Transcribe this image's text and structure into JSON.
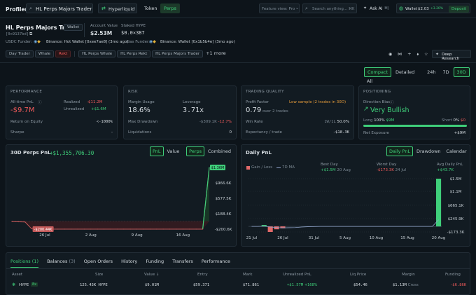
{
  "topbar": {
    "brand": "Profiler",
    "search_value": "HL Perps Majors Trader",
    "network": "Hyperliquid",
    "tab_token": "Token",
    "tab_perps": "Perps",
    "feature_view": "Feature view: Pro",
    "search_placeholder": "Search anything...",
    "search_kbd": "⌘K",
    "ask_ai": "Ask AI",
    "ask_ai_kbd": "⌘J",
    "wallet_label": "Wallet",
    "wallet_price": "$2.03",
    "wallet_change": "+3.20%",
    "deposit": "Deposit"
  },
  "profile": {
    "name": "HL Perps Majors Trader",
    "badge": "Wallet",
    "address": "[0x9137bd]",
    "account_value_label": "Account Value",
    "account_value": "$2.53M",
    "staked_label": "Staked HYPE",
    "staked_value": "$0.0×387",
    "usdc_funder_label": "USDC Funder:",
    "usdc_funder_value": "Binance: Hot Wallet [0xee7ae8] (3mo ago)",
    "gas_funder_label": "Gas Funder:",
    "gas_funder_value": "Binance: Wallet [0x1b5b4e] (3mo ago)",
    "tags": [
      "Day Trader",
      "Whale",
      "Rekt",
      "HL Perps Whale",
      "HL Perps Rekt",
      "HL Perps Majors Trader"
    ],
    "more_tags": "+1 more",
    "deep_research": "Deep Research"
  },
  "view_controls": {
    "compact": "Compact",
    "detailed": "Detailed",
    "ranges": [
      "24h",
      "7D",
      "30D",
      "All"
    ],
    "active_range": "30D"
  },
  "performance": {
    "title": "PERFORMANCE",
    "all_time_label": "All-time PnL",
    "all_time_value": "-$9.7M",
    "realized_label": "Realized",
    "realized_value": "-$11.2M",
    "unrealized_label": "Unrealized",
    "unrealized_value": "+$1.6M",
    "roe_label": "Return on Equity",
    "roe_value": "<-1000%",
    "sharpe_label": "Sharpe",
    "sharpe_value": "-"
  },
  "risk": {
    "title": "RISK",
    "margin_usage_label": "Margin Usage",
    "margin_usage_value": "18.6%",
    "leverage_label": "Leverage",
    "leverage_value": "3.71x",
    "max_drawdown_label": "Max Drawdown",
    "max_drawdown_value": "-$309.1K",
    "max_drawdown_pct": "-12.7%",
    "liquidations_label": "Liquidations",
    "liquidations_value": "0"
  },
  "trading_quality": {
    "title": "TRADING QUALITY",
    "profit_factor_label": "Profit Factor",
    "low_sample": "Low sample (2 trades in 30D)",
    "profit_factor_value": "0.79",
    "profit_factor_sub": "over 2 trades",
    "win_rate_label": "Win Rate",
    "win_rate_detail": "1W/1L",
    "win_rate_value": "50.0%",
    "expectancy_label": "Expectancy / trade",
    "expectancy_value": "-$18.3K"
  },
  "positioning": {
    "title": "POSITIONING",
    "direction_label": "Direction Bias",
    "direction_value": "Very Bullish",
    "long_label": "Long",
    "long_pct": "100%",
    "long_value": "$9M",
    "short_label": "Short",
    "short_pct": "0%",
    "short_value": "$0",
    "long_fraction": 1.0,
    "net_exposure_label": "Net Exposure",
    "net_exposure_value": "+$9M"
  },
  "pnl_chart": {
    "title": "30D Perps PnL",
    "value": "+$1,355,706.30",
    "toggle_pnl": "PnL",
    "toggle_value": "Value",
    "toggle_perps": "Perps",
    "toggle_combined": "Combined",
    "current_tag": "$1.36M",
    "min_tag": "-$200.44K"
  },
  "daily_chart": {
    "title": "Daily PnL",
    "toggle_daily": "Daily PnL",
    "toggle_drawdown": "Drawdown",
    "toggle_calendar": "Calendar",
    "legend_gain_loss": "Gain / Loss",
    "legend_ma": "7D MA",
    "best_day_label": "Best Day",
    "best_day_value": "+$1.5M",
    "best_day_date": "20 Aug",
    "worst_day_label": "Worst Day",
    "worst_day_value": "-$173.3K",
    "worst_day_date": "24 Jul",
    "avg_label": "Avg Daily PnL",
    "avg_value": "+$43.7K"
  },
  "chart_data": [
    {
      "type": "line",
      "x": [
        "21 Jul",
        "22 Jul",
        "23 Jul",
        "24 Jul",
        "25 Jul",
        "26 Jul",
        "27 Jul",
        "28 Jul",
        "29 Jul",
        "30 Jul",
        "31 Jul",
        "1 Aug",
        "2 Aug",
        "3 Aug",
        "4 Aug",
        "5 Aug",
        "6 Aug",
        "7 Aug",
        "8 Aug",
        "9 Aug",
        "10 Aug",
        "11 Aug",
        "12 Aug",
        "13 Aug",
        "14 Aug",
        "15 Aug",
        "16 Aug",
        "17 Aug",
        "18 Aug",
        "19 Aug",
        "20 Aug"
      ],
      "series": [
        {
          "values": [
            -10000,
            -15000,
            -20000,
            -193000,
            -200440,
            -200440,
            -200440,
            -200440,
            -200440,
            -200440,
            -200440,
            -200440,
            -200440,
            -200440,
            -200440,
            -200440,
            -200440,
            -200440,
            -200440,
            -200440,
            -200440,
            -200440,
            -200440,
            -200440,
            -200440,
            -200440,
            -200440,
            -200440,
            -200440,
            -200440,
            1355706
          ]
        }
      ],
      "xticks": [
        "26 Jul",
        "2 Aug",
        "9 Aug",
        "16 Aug"
      ],
      "yticks": [
        "-$200.6K",
        "$188.4K",
        "$577.5K",
        "$966.6K",
        "$1.36M"
      ],
      "ylim": [
        -200600,
        1355706
      ]
    },
    {
      "type": "bar",
      "categories": [
        "21 Jul",
        "22 Jul",
        "23 Jul",
        "24 Jul",
        "25 Jul",
        "26 Jul",
        "27 Jul",
        "28 Jul",
        "29 Jul",
        "30 Jul",
        "31 Jul",
        "1 Aug",
        "2 Aug",
        "3 Aug",
        "4 Aug",
        "5 Aug",
        "6 Aug",
        "7 Aug",
        "8 Aug",
        "9 Aug",
        "10 Aug",
        "11 Aug",
        "12 Aug",
        "13 Aug",
        "14 Aug",
        "15 Aug",
        "16 Aug",
        "17 Aug",
        "18 Aug",
        "19 Aug",
        "20 Aug"
      ],
      "series": [
        {
          "name": "Gain / Loss",
          "values": [
            0,
            0,
            45000,
            -173300,
            -90000,
            -60000,
            0,
            0,
            0,
            0,
            0,
            0,
            0,
            0,
            0,
            0,
            0,
            0,
            0,
            0,
            0,
            0,
            0,
            0,
            0,
            0,
            0,
            0,
            0,
            0,
            1500000
          ]
        },
        {
          "name": "7D MA",
          "values": [
            0,
            0,
            10000,
            -20000,
            -35000,
            -45000,
            -40000,
            -35000,
            -20000,
            -10000,
            -5000,
            0,
            0,
            0,
            0,
            0,
            0,
            0,
            0,
            0,
            0,
            0,
            0,
            0,
            0,
            0,
            0,
            0,
            0,
            0,
            210000
          ]
        }
      ],
      "xticks": [
        "21 Jul",
        "26 Jul",
        "31 Jul",
        "5 Aug",
        "10 Aug",
        "15 Aug",
        "20 Aug"
      ],
      "yticks": [
        "-$173.3K",
        "$245.9K",
        "$665.1K",
        "$1.1M",
        "$1.5M"
      ],
      "ylim": [
        -173300,
        1500000
      ]
    }
  ],
  "positions": {
    "tabs": [
      {
        "label": "Positions",
        "count": "(1)"
      },
      {
        "label": "Balances",
        "count": "(3)"
      },
      {
        "label": "Open Orders",
        "count": ""
      },
      {
        "label": "History",
        "count": ""
      },
      {
        "label": "Funding",
        "count": ""
      },
      {
        "label": "Transfers",
        "count": ""
      },
      {
        "label": "Performance",
        "count": ""
      }
    ],
    "headers": {
      "asset": "Asset",
      "size": "Size",
      "value": "Value ↓",
      "entry": "Entry",
      "mark": "Mark",
      "upnl": "Unrealized PnL",
      "liq": "Liq Price",
      "margin": "Margin",
      "funding": "Funding"
    },
    "row": {
      "asset": "HYPE",
      "lev": "8x",
      "size": "125.43K HYPE",
      "value": "$9.01M",
      "entry": "$59.371",
      "mark": "$71.861",
      "upnl": "+$1.57M",
      "upnl_pct": "+168%",
      "liq": "$54.46",
      "margin": "$1.13M",
      "margin_mode": "Cross",
      "funding": "-$6.86K"
    }
  },
  "colors": {
    "accent": "#3fcf7a",
    "negative": "#ef5a5a",
    "warning": "#e39a3a",
    "background": "#0d141a"
  }
}
